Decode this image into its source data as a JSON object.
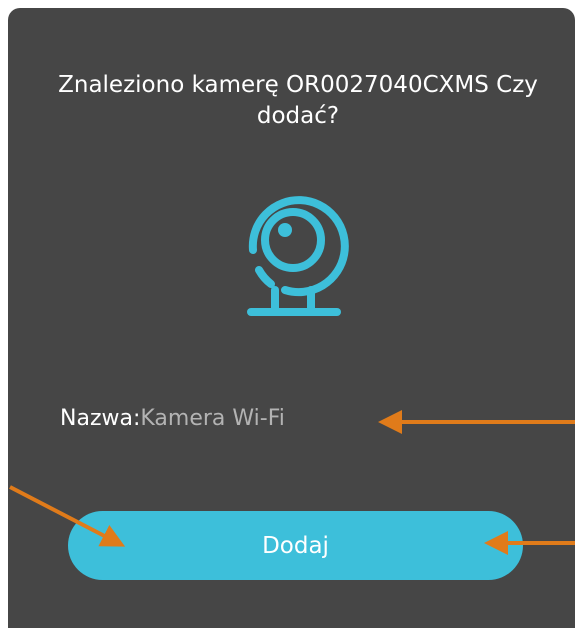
{
  "dialog": {
    "title": "Znaleziono kamerę  OR0027040CXMS Czy dodać?",
    "icon": "webcam-icon",
    "name_label": "Nazwa:",
    "name_value": "Kamera Wi-Fi",
    "add_button_label": "Dodaj"
  },
  "colors": {
    "dialog_background": "#464646",
    "accent": "#3dbfda",
    "annotation_arrow": "#e07b1a",
    "name_value_text": "#b3b3b3"
  },
  "annotations": {
    "icon": "arrow-icon",
    "count": 3
  }
}
